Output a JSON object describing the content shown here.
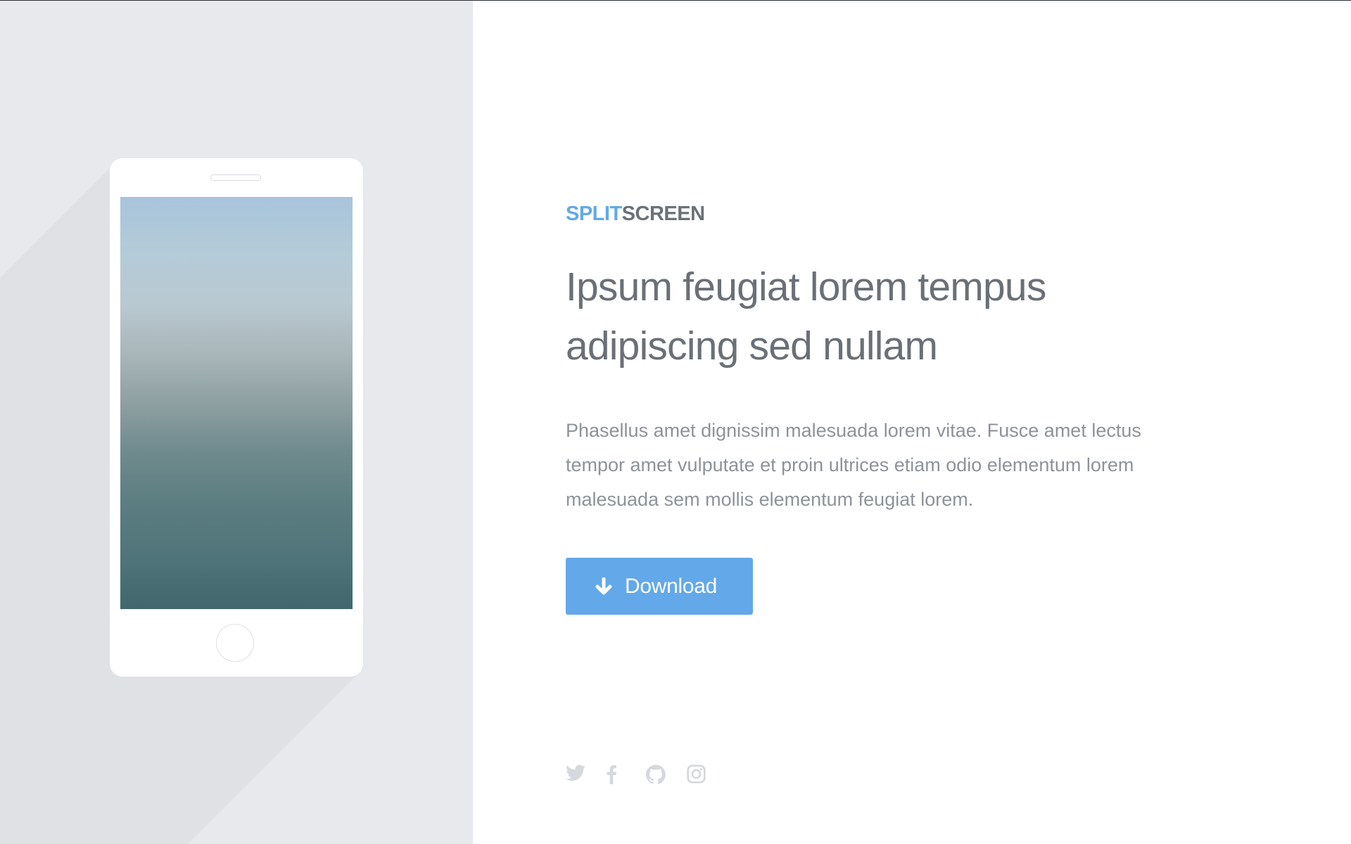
{
  "brand": {
    "part1": "SPLIT",
    "part2": "SCREEN",
    "accent_color": "#62a9e8"
  },
  "headline": "Ipsum feugiat lorem tempus adipiscing sed nullam",
  "description": "Phasellus amet dignissim malesuada lorem vitae. Fusce amet lectus tempor amet vulputate et proin ultrices etiam odio elementum lorem malesuada sem mollis elementum feugiat lorem.",
  "download_button": {
    "label": "Download",
    "icon": "arrow-down-icon",
    "color": "#63a8e8"
  },
  "social": [
    {
      "name": "twitter",
      "icon": "twitter-icon"
    },
    {
      "name": "facebook",
      "icon": "facebook-icon"
    },
    {
      "name": "github",
      "icon": "github-icon"
    },
    {
      "name": "instagram",
      "icon": "instagram-icon"
    }
  ],
  "colors": {
    "left_panel": "#e7e9ed",
    "icon_gray": "#d5d8dc"
  }
}
